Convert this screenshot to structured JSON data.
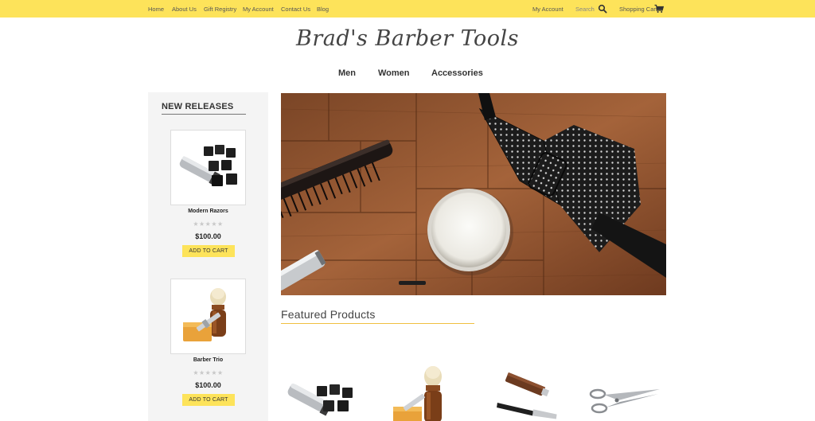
{
  "topbar": {
    "links": [
      "Home",
      "About Us",
      "Gift Registry",
      "My Account",
      "Contact Us",
      "Blog"
    ],
    "account": "My Account",
    "search_label": "Search",
    "cart_label": "Shopping Cart",
    "background_color": "#fde35a"
  },
  "logo": "Brad's Barber Tools",
  "nav": [
    "Men",
    "Women",
    "Accessories"
  ],
  "sidebar": {
    "title": "NEW RELEASES",
    "products": [
      {
        "name": "Modern Razors",
        "rating": 0,
        "price": "$100.00",
        "button": "ADD TO CART",
        "image": "clipper-set"
      },
      {
        "name": "Barber Trio",
        "rating": 0,
        "price": "$100.00",
        "button": "ADD TO CART",
        "image": "shaving-brush-set"
      }
    ]
  },
  "hero": {
    "image": "barber tools with bow tie on wooden table"
  },
  "featured": {
    "title": "Featured Products",
    "items": [
      "clipper-set",
      "shaving-brush-set",
      "straight-razor",
      "barber-scissors"
    ]
  },
  "colors": {
    "accent": "#fde35a",
    "sidebar_bg": "#f4f4f4"
  }
}
